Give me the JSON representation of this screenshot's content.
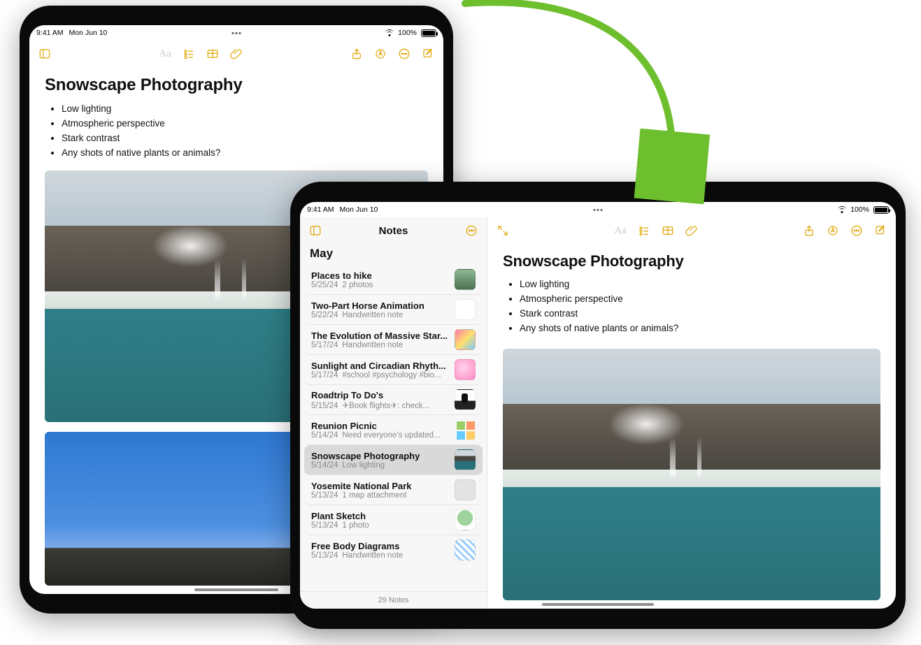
{
  "status": {
    "time": "9:41 AM",
    "date": "Mon Jun 10",
    "battery_pct": "100%"
  },
  "note": {
    "title": "Snowscape Photography",
    "bullets": [
      "Low lighting",
      "Atmospheric perspective",
      "Stark contrast",
      "Any shots of native plants or animals?"
    ]
  },
  "sidebar": {
    "title": "Notes",
    "section": "May",
    "footer": "29 Notes",
    "items": [
      {
        "title": "Places to hike",
        "date": "5/25/24",
        "preview": "2 photos",
        "thumb": "photo-nature"
      },
      {
        "title": "Two-Part Horse Animation",
        "date": "5/22/24",
        "preview": "Handwritten note",
        "thumb": "empty"
      },
      {
        "title": "The Evolution of Massive Star...",
        "date": "5/17/24",
        "preview": "Handwritten note",
        "thumb": "ribbons"
      },
      {
        "title": "Sunlight and Circadian Rhyth...",
        "date": "5/17/24",
        "preview": "#school #psychology #bio...",
        "thumb": "pink"
      },
      {
        "title": "Roadtrip To Do's",
        "date": "5/15/24",
        "preview": "✈︎Book flights✈︎: check...",
        "thumb": "hiker"
      },
      {
        "title": "Reunion Picnic",
        "date": "5/14/24",
        "preview": "Need everyone's updated...",
        "thumb": "collage"
      },
      {
        "title": "Snowscape Photography",
        "date": "5/14/24",
        "preview": "Low lighting",
        "thumb": "waterfall-t",
        "selected": true
      },
      {
        "title": "Yosemite National Park",
        "date": "5/13/24",
        "preview": "1 map attachment",
        "thumb": ""
      },
      {
        "title": "Plant Sketch",
        "date": "5/13/24",
        "preview": "1 photo",
        "thumb": "leaf"
      },
      {
        "title": "Free Body Diagrams",
        "date": "5/13/24",
        "preview": "Handwritten note",
        "thumb": "diag"
      }
    ]
  },
  "icons": {
    "Aa": "Aa"
  }
}
